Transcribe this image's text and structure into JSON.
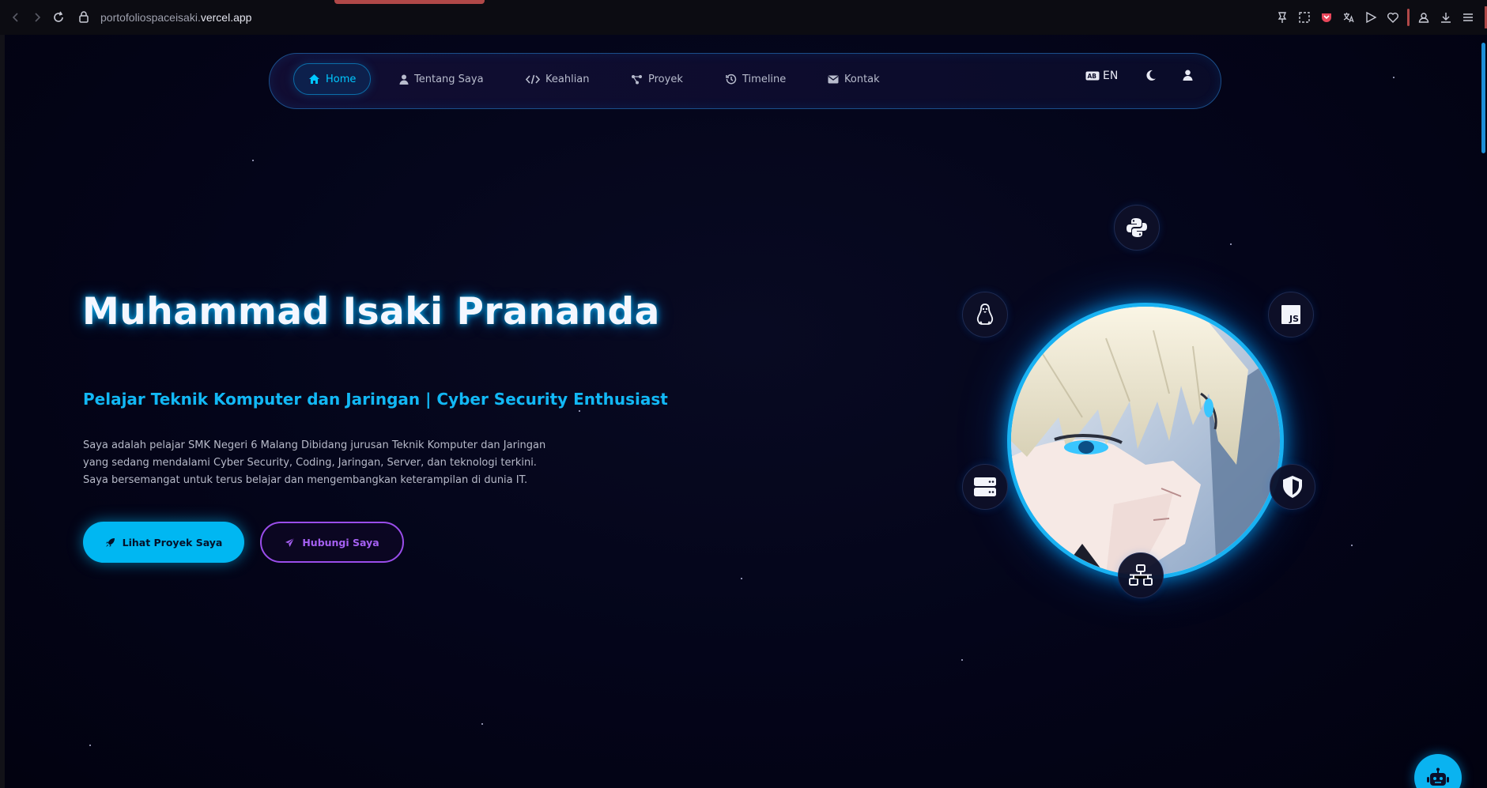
{
  "browser": {
    "url_prefix": "portofoliospaceisaki.",
    "url_domain": "vercel.app"
  },
  "nav": {
    "items": [
      {
        "label": "Home",
        "icon": "home-icon",
        "active": true
      },
      {
        "label": "Tentang Saya",
        "icon": "user-icon"
      },
      {
        "label": "Keahlian",
        "icon": "code-icon"
      },
      {
        "label": "Proyek",
        "icon": "project-icon"
      },
      {
        "label": "Timeline",
        "icon": "history-icon"
      },
      {
        "label": "Kontak",
        "icon": "mail-icon"
      }
    ],
    "language": "EN",
    "language_icon": "language-icon",
    "theme_icon": "moon-icon",
    "account_icon": "user-icon"
  },
  "hero": {
    "title": "Muhammad Isaki Prananda",
    "subtitle": "Pelajar Teknik Komputer dan Jaringan | Cyber Security Enthusiast",
    "description_lines": [
      "Saya adalah pelajar SMK Negeri 6 Malang Dibidang jurusan Teknik Komputer dan Jaringan",
      "yang sedang mendalami Cyber Security, Coding, Jaringan, Server, dan teknologi terkini.",
      "Saya bersemangat untuk terus belajar dan mengembangkan keterampilan di dunia IT."
    ],
    "primary_button": "Lihat Proyek Saya",
    "secondary_button": "Hubungi Saya"
  },
  "orbit_icons": [
    "python-icon",
    "linux-icon",
    "javascript-icon",
    "server-icon",
    "shield-icon",
    "network-icon"
  ],
  "colors": {
    "accent": "#00b7f2",
    "secondary": "#9a4dea",
    "background": "#03030f"
  },
  "chatbot_icon": "robot-icon"
}
